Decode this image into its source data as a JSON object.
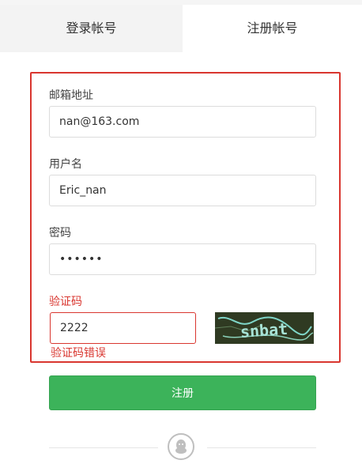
{
  "tabs": {
    "login": "登录帐号",
    "register": "注册帐号"
  },
  "form": {
    "email_label": "邮箱地址",
    "email_value": "nan@163.com",
    "username_label": "用户名",
    "username_value": "Eric_nan",
    "password_label": "密码",
    "password_value": "••••••",
    "captcha_label": "验证码",
    "captcha_value": "2222",
    "captcha_image_text": "snbat",
    "captcha_error": "验证码错误",
    "submit_label": "注册"
  },
  "icons": {
    "social_login": "qq-icon"
  },
  "colors": {
    "error": "#d9362f",
    "primary": "#3cb35a"
  }
}
